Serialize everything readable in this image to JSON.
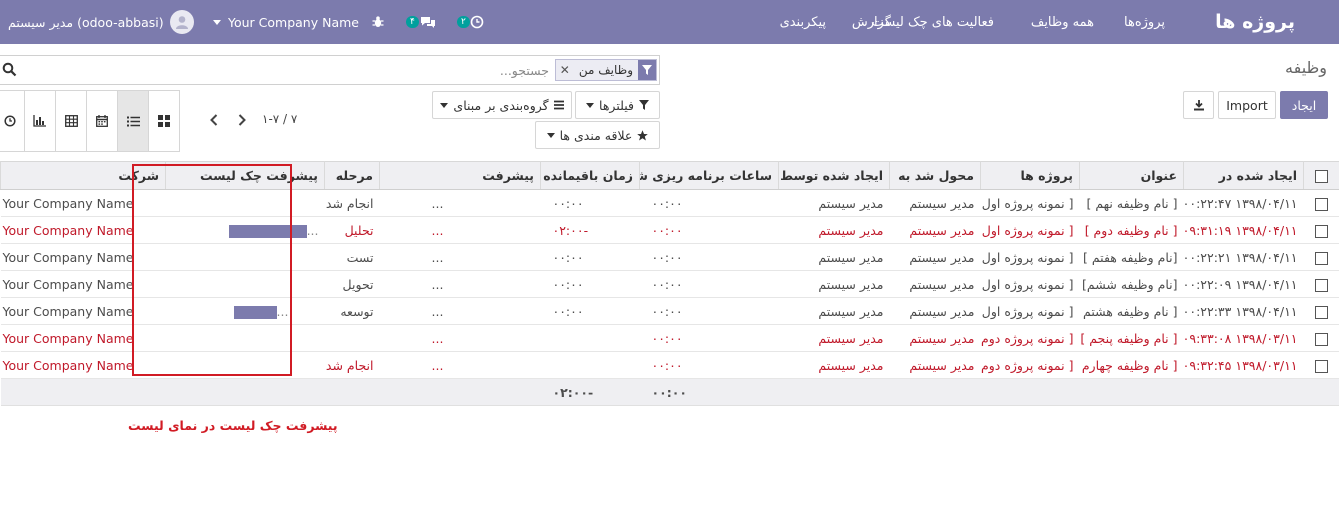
{
  "header": {
    "brand": "پروژه ها",
    "menu": [
      "پروژه‌ها",
      "همه وظایف",
      "فعالیت های چک لیست",
      "گزارش",
      "پیکربندی"
    ],
    "activity_count": "۲",
    "message_count": "۴",
    "company": "Your Company Name",
    "user": "مدیر سیستم (odoo-abbasi)"
  },
  "breadcrumb": "وظیفه",
  "search": {
    "facet_label": "وظایف من",
    "placeholder": "جستجو..."
  },
  "buttons": {
    "create": "ایجاد",
    "import": "Import",
    "filters": "فیلترها",
    "group_by": "گروه‌بندی بر مبنای",
    "favorites": "علاقه مندی ها"
  },
  "pager": "۱-۷ / ۷",
  "table": {
    "columns": [
      "ایجاد شده در",
      "عنوان",
      "پروژه ها",
      "محول شد به",
      "ایجاد شده توسط",
      "ساعات برنامه ریزی شده",
      "زمان باقیمانده",
      "پیشرفت",
      "مرحله",
      "پیشرفت چک لیست",
      "شرکت"
    ],
    "rows": [
      {
        "created": "۱۳۹۸/۰۴/۱۱ ۰۰:۲۲:۴۷",
        "title": "[ نام وظیفه نهم ]",
        "project": "[ نمونه پروژه اول ]",
        "assigned": "مدیر سیستم",
        "creator": "مدیر سیستم",
        "planned": "۰۰:۰۰",
        "remaining": "۰۰:۰۰",
        "progress": "...",
        "stage": "انجام شد",
        "checklist": 0,
        "checklist_text": "",
        "company": "Your Company Name",
        "red": false
      },
      {
        "created": "۱۳۹۸/۰۴/۱۱ ۰۹:۳۱:۱۹",
        "title": "[ نام وظیفه دوم ]",
        "project": "[ نمونه پروژه اول ]",
        "assigned": "مدیر سیستم",
        "creator": "مدیر سیستم",
        "planned": "۰۰:۰۰",
        "remaining": "-۰۲:۰۰",
        "progress": "...",
        "stage": "تحلیل",
        "checklist": 1.0,
        "checklist_text": "...",
        "company": "Your Company Name",
        "red": true
      },
      {
        "created": "۱۳۹۸/۰۴/۱۱ ۰۰:۲۲:۲۱",
        "title": "[نام وظیفه هفتم ]",
        "project": "[ نمونه پروژه اول ]",
        "assigned": "مدیر سیستم",
        "creator": "مدیر سیستم",
        "planned": "۰۰:۰۰",
        "remaining": "۰۰:۰۰",
        "progress": "...",
        "stage": "تست",
        "checklist": 0,
        "checklist_text": "",
        "company": "Your Company Name",
        "red": false
      },
      {
        "created": "۱۳۹۸/۰۴/۱۱ ۰۰:۲۲:۰۹",
        "title": "[نام وظیفه ششم]",
        "project": "[ نمونه پروژه اول ]",
        "assigned": "مدیر سیستم",
        "creator": "مدیر سیستم",
        "planned": "۰۰:۰۰",
        "remaining": "۰۰:۰۰",
        "progress": "...",
        "stage": "تحویل",
        "checklist": 0,
        "checklist_text": "",
        "company": "Your Company Name",
        "red": false
      },
      {
        "created": "۱۳۹۸/۰۴/۱۱ ۰۰:۲۲:۳۳",
        "title": "[ نام وظیفه هشتم ]",
        "project": "[ نمونه پروژه اول ]",
        "assigned": "مدیر سیستم",
        "creator": "مدیر سیستم",
        "planned": "۰۰:۰۰",
        "remaining": "۰۰:۰۰",
        "progress": "...",
        "stage": "توسعه",
        "checklist": 0.55,
        "checklist_text": "...",
        "company": "Your Company Name",
        "red": false
      },
      {
        "created": "۱۳۹۸/۰۳/۱۱ ۰۹:۳۳:۰۸",
        "title": "[ نام وظیفه پنجم ]",
        "project": "[ نمونه پروژه دوم ]",
        "assigned": "مدیر سیستم",
        "creator": "مدیر سیستم",
        "planned": "۰۰:۰۰",
        "remaining": "",
        "progress": "...",
        "stage": "",
        "checklist": 0,
        "checklist_text": "",
        "company": "Your Company Name",
        "red": true
      },
      {
        "created": "۱۳۹۸/۰۳/۱۱ ۰۹:۳۲:۴۵",
        "title": "[ نام وظیفه چهارم ]",
        "project": "[ نمونه پروژه دوم ]",
        "assigned": "مدیر سیستم",
        "creator": "مدیر سیستم",
        "planned": "۰۰:۰۰",
        "remaining": "",
        "progress": "...",
        "stage": "انجام شد",
        "checklist": 0,
        "checklist_text": "",
        "company": "Your Company Name",
        "red": true
      }
    ],
    "totals": {
      "planned": "۰۰:۰۰",
      "remaining": "-۰۲:۰۰"
    }
  },
  "caption": "پیشرفت چک لیست در نمای لیست",
  "colors": {
    "brand": "#7c7bad",
    "highlight": "#d11b24",
    "overdue": "#c0192a"
  }
}
